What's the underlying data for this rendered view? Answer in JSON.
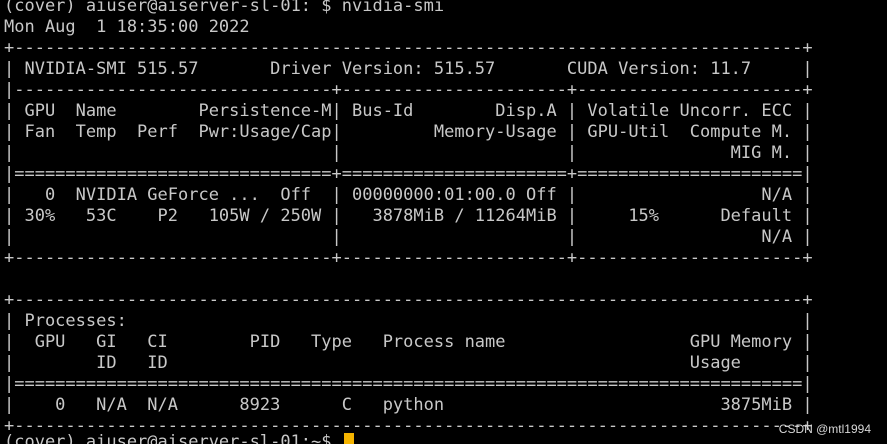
{
  "theme": {
    "background": "#000000",
    "foreground": "#c8c8c8",
    "cursor_color": "#f5b400",
    "watermark_color": "#d8d8d8"
  },
  "terminal": {
    "lines": [
      "(cover) aiuser@aiserver-sl-01: $ nvidia-smi",
      "Mon Aug  1 18:35:00 2022",
      "+-----------------------------------------------------------------------------+",
      "| NVIDIA-SMI 515.57       Driver Version: 515.57       CUDA Version: 11.7     |",
      "|-------------------------------+----------------------+----------------------+",
      "| GPU  Name        Persistence-M| Bus-Id        Disp.A | Volatile Uncorr. ECC |",
      "| Fan  Temp  Perf  Pwr:Usage/Cap|         Memory-Usage | GPU-Util  Compute M. |",
      "|                               |                      |               MIG M. |",
      "|===============================+======================+======================|",
      "|   0  NVIDIA GeForce ...  Off  | 00000000:01:00.0 Off |                  N/A |",
      "| 30%   53C    P2   105W / 250W |   3878MiB / 11264MiB |     15%      Default |",
      "|                               |                      |                  N/A |",
      "+-------------------------------+----------------------+----------------------+",
      "",
      "+-----------------------------------------------------------------------------+",
      "| Processes:                                                                  |",
      "|  GPU   GI   CI        PID   Type   Process name                  GPU Memory |",
      "|        ID   ID                                                   Usage      |",
      "|=============================================================================|",
      "|    0   N/A  N/A      8923      C   python                           3875MiB |",
      "+-----------------------------------------------------------------------------+"
    ],
    "prompt_line": "(cover) aiuser@aiserver-sl-01:~$ "
  },
  "watermark": "CSDN @mtl1994"
}
